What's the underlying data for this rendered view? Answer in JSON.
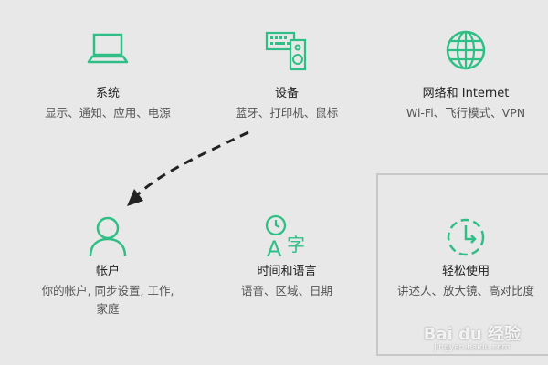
{
  "colors": {
    "accent": "#2fbf86",
    "background": "#e8e8e8",
    "arrow": "#222222"
  },
  "tiles": {
    "system": {
      "title": "系统",
      "desc": "显示、通知、应用、电源",
      "icon": "laptop-icon"
    },
    "devices": {
      "title": "设备",
      "desc": "蓝牙、打印机、鼠标",
      "icon": "devices-icon"
    },
    "network": {
      "title": "网络和 Internet",
      "desc": "Wi-Fi、飞行模式、VPN",
      "icon": "globe-icon"
    },
    "accounts": {
      "title": "帐户",
      "desc": "你的帐户, 同步设置, 工作, 家庭",
      "icon": "person-icon"
    },
    "time": {
      "title": "时间和语言",
      "desc": "语音、区域、日期",
      "icon": "time-language-icon"
    },
    "ease": {
      "title": "轻松使用",
      "desc": "讲述人、放大镜、高对比度",
      "icon": "ease-of-access-icon"
    }
  },
  "watermark": {
    "brand": "Bai du 经验",
    "url": "jingyan.baidu.com"
  }
}
